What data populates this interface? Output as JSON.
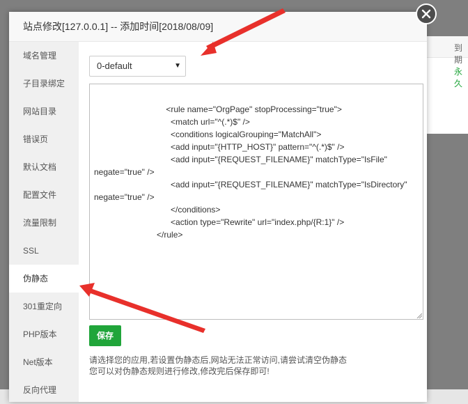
{
  "background": {
    "col_header": "到期",
    "col_value": "永久"
  },
  "modal": {
    "title": "站点修改[127.0.0.1] -- 添加时间[2018/08/09]"
  },
  "sidebar": {
    "items": [
      {
        "label": "域名管理"
      },
      {
        "label": "子目录绑定"
      },
      {
        "label": "网站目录"
      },
      {
        "label": "错误页"
      },
      {
        "label": "默认文档"
      },
      {
        "label": "配置文件"
      },
      {
        "label": "流量限制"
      },
      {
        "label": "SSL"
      },
      {
        "label": "伪静态",
        "active": true
      },
      {
        "label": "301重定向"
      },
      {
        "label": "PHP版本"
      },
      {
        "label": "Net版本"
      },
      {
        "label": "反向代理"
      }
    ]
  },
  "rewrite": {
    "selected_template": "0-default",
    "code": "                               <rule name=\"OrgPage\" stopProcessing=\"true\">\n                                 <match url=\"^(.*)$\" />\n                                 <conditions logicalGrouping=\"MatchAll\">\n                                 <add input=\"{HTTP_HOST}\" pattern=\"^(.*)$\" />\n                                 <add input=\"{REQUEST_FILENAME}\" matchType=\"IsFile\" negate=\"true\" />\n                                 <add input=\"{REQUEST_FILENAME}\" matchType=\"IsDirectory\" negate=\"true\" />\n                                 </conditions>\n                                 <action type=\"Rewrite\" url=\"index.php/{R:1}\" />\n                           </rule>",
    "save_label": "保存",
    "note_1": "请选择您的应用,若设置伪静态后,网站无法正常访问,请尝试清空伪静态",
    "note_2": "您可以对伪静态规则进行修改,修改完后保存即可!"
  },
  "colors": {
    "accent_green": "#20a53a",
    "annotation_red": "#e8302b"
  }
}
